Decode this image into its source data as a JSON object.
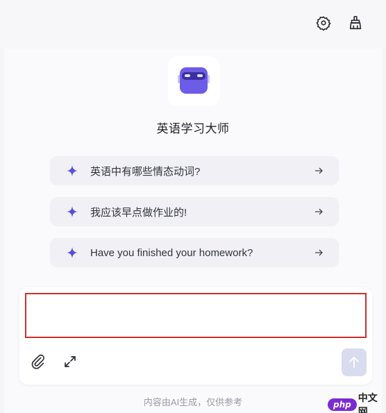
{
  "bot": {
    "name": "英语学习大师",
    "avatar_icon": "robot-icon"
  },
  "header": {
    "settings_icon": "gear-icon",
    "clean_icon": "broom-icon"
  },
  "suggestions": [
    {
      "text": "英语中有哪些情态动词?"
    },
    {
      "text": "我应该早点做作业的!"
    },
    {
      "text": "Have you finished your homework?"
    }
  ],
  "composer": {
    "input_value": "",
    "input_placeholder": "",
    "attach_icon": "paperclip-icon",
    "expand_icon": "expand-icon",
    "send_icon": "arrow-up-icon"
  },
  "footer": {
    "note": "内容由AI生成，仅供参考"
  },
  "watermark": {
    "php": "php",
    "cn": "中文网"
  },
  "colors": {
    "accent": "#5b4fd6",
    "input_border": "#c9302c",
    "send_disabled": "#d9dcee"
  }
}
